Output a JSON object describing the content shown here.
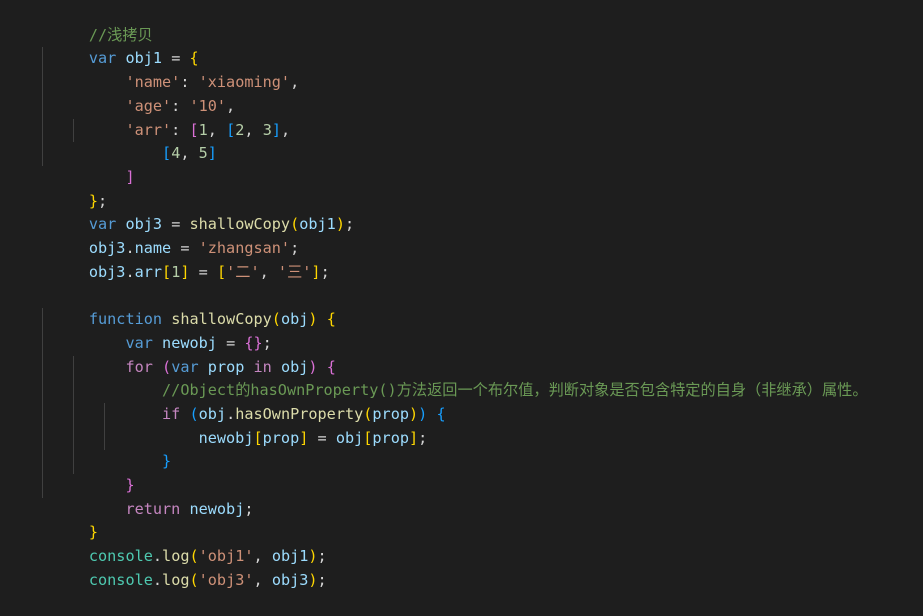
{
  "editor": {
    "language": "javascript",
    "theme": "Dark+ (default dark)",
    "background_color": "#1e1e1e",
    "foreground_color": "#d4d4d4",
    "font_size_px": 15.2,
    "line_height_px": 23.7,
    "indent_guide_color": "#404040",
    "total_lines": 24
  },
  "palette": {
    "comment": "#6a9955",
    "keyword": "#569cd6",
    "control_keyword": "#c586c0",
    "variable": "#9cdcfe",
    "string": "#ce9178",
    "number": "#b5cea8",
    "function": "#dcdcaa",
    "class_builtin": "#4ec9b0",
    "plain": "#d4d4d4",
    "bracket_level_1": "#ffd700",
    "bracket_level_2": "#da70d6",
    "bracket_level_3": "#179fff"
  },
  "code": {
    "full_text": "//浅拷贝\nvar obj1 = {\n    'name': 'xiaoming',\n    'age': '10',\n    'arr': [1, [2, 3],\n        [4, 5]\n    ]\n};\nvar obj3 = shallowCopy(obj1);\nobj3.name = 'zhangsan';\nobj3.arr[1] = ['二', '三'];\n\nfunction shallowCopy(obj) {\n    var newobj = {};\n    for (var prop in obj) {\n        //Object的hasOwnProperty()方法返回一个布尔值，判断对象是否包含特定的自身（非继承）属性。\n        if (obj.hasOwnProperty(prop)) {\n            newobj[prop] = obj[prop];\n        }\n    }\n    return newobj;\n}\nconsole.log('obj1', obj1);\nconsole.log('obj3', obj3);",
    "lines": [
      {
        "n": 1,
        "text": "//浅拷贝"
      },
      {
        "n": 2,
        "text": "var obj1 = {"
      },
      {
        "n": 3,
        "text": "    'name': 'xiaoming',"
      },
      {
        "n": 4,
        "text": "    'age': '10',"
      },
      {
        "n": 5,
        "text": "    'arr': [1, [2, 3],"
      },
      {
        "n": 6,
        "text": "        [4, 5]"
      },
      {
        "n": 7,
        "text": "    ]"
      },
      {
        "n": 8,
        "text": "};"
      },
      {
        "n": 9,
        "text": "var obj3 = shallowCopy(obj1);"
      },
      {
        "n": 10,
        "text": "obj3.name = 'zhangsan';"
      },
      {
        "n": 11,
        "text": "obj3.arr[1] = ['二', '三'];"
      },
      {
        "n": 12,
        "text": ""
      },
      {
        "n": 13,
        "text": "function shallowCopy(obj) {"
      },
      {
        "n": 14,
        "text": "    var newobj = {};"
      },
      {
        "n": 15,
        "text": "    for (var prop in obj) {"
      },
      {
        "n": 16,
        "text": "        //Object的hasOwnProperty()方法返回一个布尔值，判断对象是否包含特定的自身（非继承）属性。"
      },
      {
        "n": 17,
        "text": "        if (obj.hasOwnProperty(prop)) {"
      },
      {
        "n": 18,
        "text": "            newobj[prop] = obj[prop];"
      },
      {
        "n": 19,
        "text": "        }"
      },
      {
        "n": 20,
        "text": "    }"
      },
      {
        "n": 21,
        "text": "    return newobj;"
      },
      {
        "n": 22,
        "text": "}"
      },
      {
        "n": 23,
        "text": "console.log('obj1', obj1);"
      },
      {
        "n": 24,
        "text": "console.log('obj3', obj3);"
      }
    ],
    "comments": [
      "//浅拷贝",
      "//Object的hasOwnProperty()方法返回一个布尔值，判断对象是否包含特定的自身（非继承）属性。"
    ],
    "identifiers": [
      "obj1",
      "obj3",
      "obj",
      "prop",
      "newobj",
      "shallowCopy",
      "hasOwnProperty",
      "console",
      "log",
      "name",
      "age",
      "arr"
    ],
    "keywords": [
      "var",
      "function",
      "for",
      "in",
      "if",
      "return"
    ],
    "strings": [
      "'name'",
      "'xiaoming'",
      "'age'",
      "'10'",
      "'arr'",
      "'zhangsan'",
      "'二'",
      "'三'",
      "'obj1'",
      "'obj3'"
    ],
    "numbers": [
      "1",
      "2",
      "3",
      "4",
      "5",
      "10"
    ]
  }
}
